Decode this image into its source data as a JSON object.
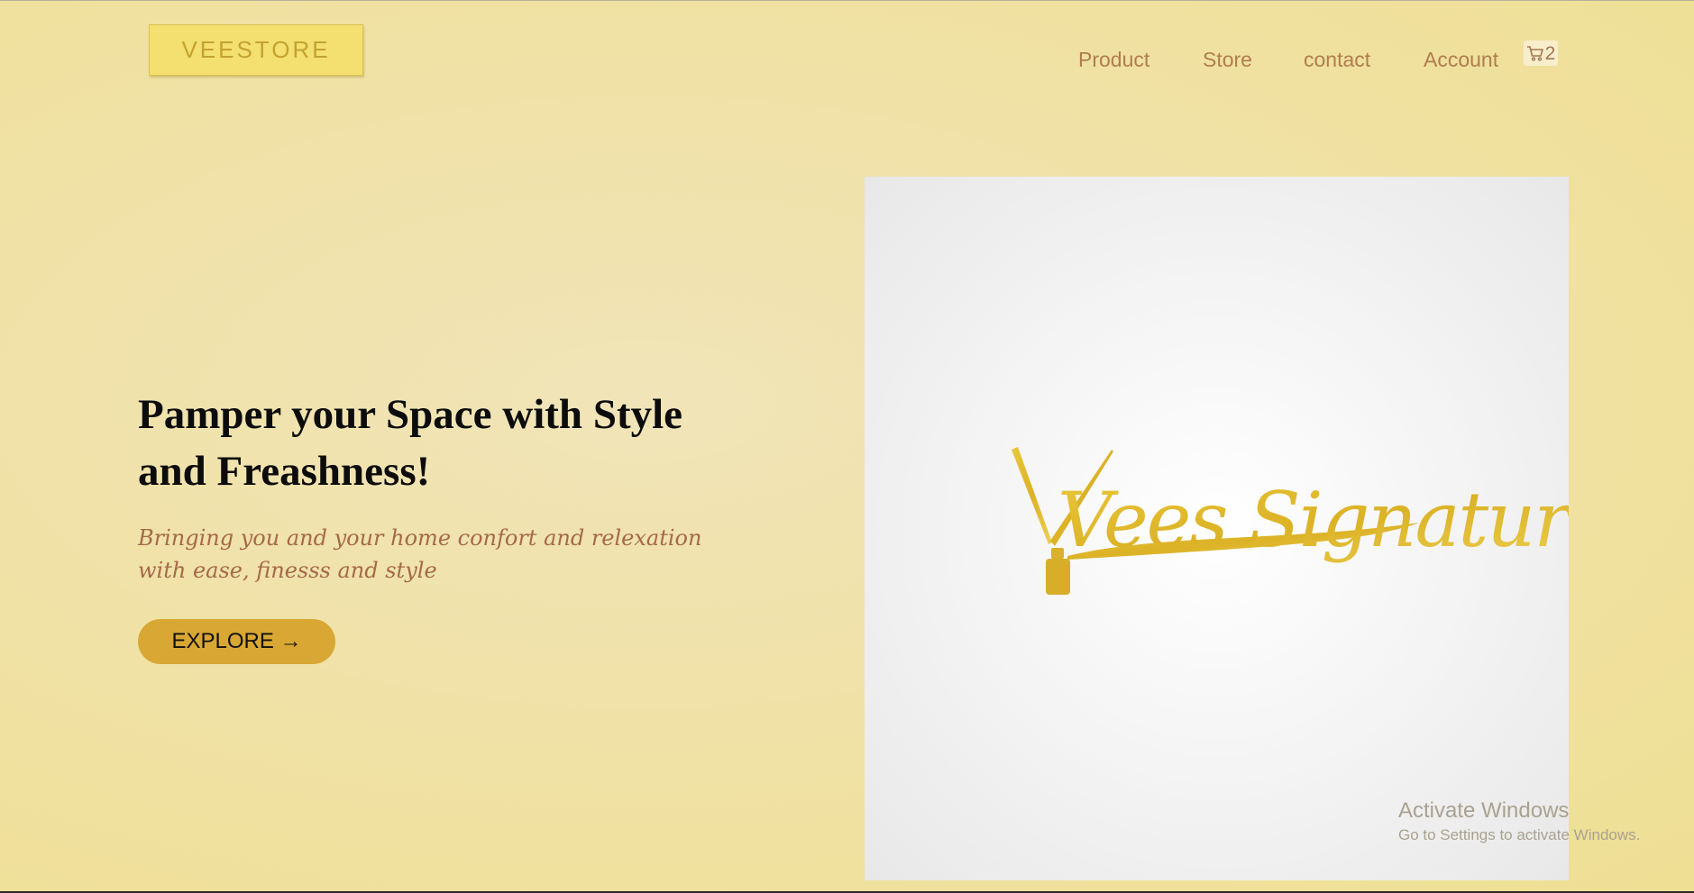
{
  "header": {
    "logo_text": "VEESTORE",
    "nav": [
      {
        "label": "Product"
      },
      {
        "label": "Store"
      },
      {
        "label": "contact"
      },
      {
        "label": "Account"
      }
    ],
    "cart": {
      "icon": "cart-icon",
      "count": "2"
    }
  },
  "hero": {
    "headline": "Pamper your Space with Style and Freashness!",
    "tagline": "Bringing you and your home confort and relexation with ease, finesss and style",
    "cta_label": "EXPLORE →",
    "image": {
      "logo_text": "Vees Signature"
    }
  },
  "watermark": {
    "title": "Activate Windows",
    "subtitle": "Go to Settings to activate Windows."
  },
  "colors": {
    "background": "#f0e2a7",
    "accent": "#d9a733",
    "nav_text": "#b07d4e",
    "tagline": "#a5694a",
    "logo_box": "#f3e070",
    "brand_gold": "#e0bb28"
  }
}
